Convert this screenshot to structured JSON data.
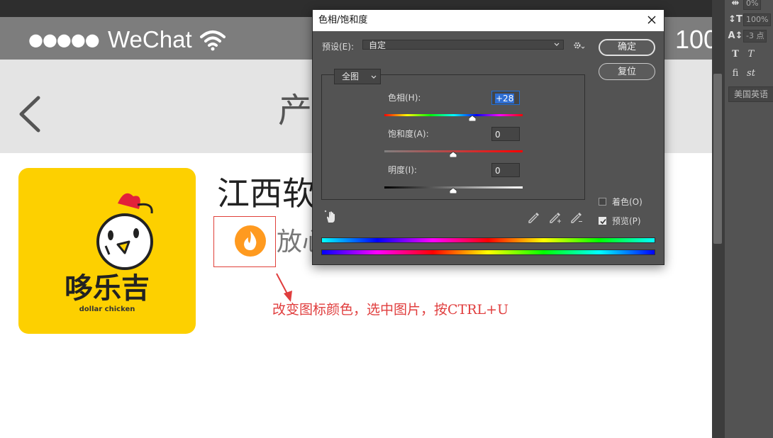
{
  "phone": {
    "signal_dots": "●●●●●",
    "carrier": "WeChat",
    "battery": "100",
    "nav_title": "产",
    "app_logo": {
      "brand": "哆乐吉",
      "sub": "dollar chicken"
    },
    "company_name": "江西软",
    "slogan": "放心",
    "annotation": "改变图标颜色，选中图片，按CTRL+U"
  },
  "ps_panel": {
    "tracking_value": "0%",
    "vertical_scale": "100%",
    "baseline_shift": "-3 点",
    "faux_bold": "T",
    "faux_italic": "T",
    "ligature": "fi",
    "swash": "st",
    "language": "美国英语"
  },
  "dialog": {
    "title": "色相/饱和度",
    "preset_label": "预设(E):",
    "preset_value": "自定",
    "ok_label": "确定",
    "reset_label": "复位",
    "channel_value": "全图",
    "hue_label": "色相(H):",
    "hue_value": "+28",
    "saturation_label": "饱和度(A):",
    "saturation_value": "0",
    "lightness_label": "明度(I):",
    "lightness_value": "0",
    "colorize_label": "着色(O)",
    "preview_label": "预览(P)"
  },
  "colors": {
    "annotation_red": "#e03d3d",
    "logo_yellow": "#fdd000",
    "flame_orange": "#ff9a1f",
    "dialog_bg": "#535353"
  }
}
